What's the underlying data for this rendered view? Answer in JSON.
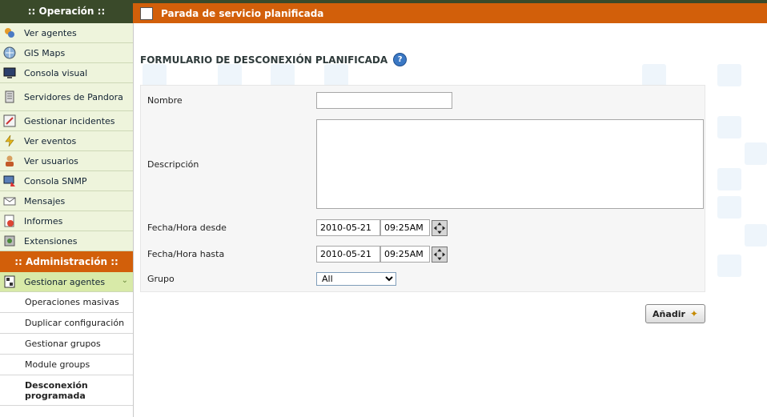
{
  "window": {
    "title": "Parada de servicio planificada"
  },
  "sidebar": {
    "operation_header": ":: Operación ::",
    "operation_items": [
      {
        "label": "Ver agentes",
        "icon": "agents-icon"
      },
      {
        "label": "GIS Maps",
        "icon": "gis-icon"
      },
      {
        "label": "Consola visual",
        "icon": "monitor-icon"
      },
      {
        "label": "Servidores de Pandora",
        "icon": "server-icon"
      },
      {
        "label": "Gestionar incidentes",
        "icon": "incident-icon"
      },
      {
        "label": "Ver eventos",
        "icon": "events-icon"
      },
      {
        "label": "Ver usuarios",
        "icon": "users-icon"
      },
      {
        "label": "Consola SNMP",
        "icon": "snmp-icon"
      },
      {
        "label": "Mensajes",
        "icon": "mail-icon"
      },
      {
        "label": "Informes",
        "icon": "report-icon"
      },
      {
        "label": "Extensiones",
        "icon": "extensions-icon"
      }
    ],
    "admin_header": ":: Administración ::",
    "admin_item": {
      "label": "Gestionar agentes",
      "icon": "manage-agents-icon"
    },
    "admin_sub_items": [
      {
        "label": "Operaciones masivas"
      },
      {
        "label": "Duplicar configuración"
      },
      {
        "label": "Gestionar grupos"
      },
      {
        "label": "Module groups"
      },
      {
        "label": "Desconexión programada"
      }
    ]
  },
  "form": {
    "title": "FORMULARIO DE DESCONEXIÓN PLANIFICADA",
    "help_symbol": "?",
    "name_label": "Nombre",
    "name_value": "",
    "description_label": "Descripción",
    "description_value": "",
    "from_label": "Fecha/Hora desde",
    "from_date": "2010-05-21",
    "from_time": "09:25AM",
    "to_label": "Fecha/Hora hasta",
    "to_date": "2010-05-21",
    "to_time": "09:25AM",
    "group_label": "Grupo",
    "group_selected": "All",
    "add_button": "Añadir"
  },
  "colors": {
    "accent_orange": "#d25f0a",
    "dark_green": "#3a4a2a",
    "menu_bg": "#eef4dc"
  }
}
